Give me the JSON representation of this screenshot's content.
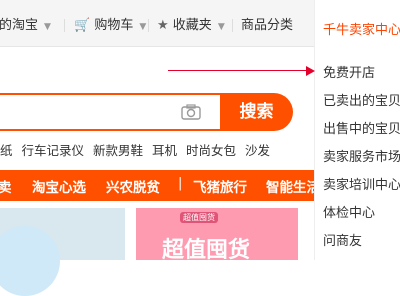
{
  "topbar": {
    "my_taobao": "我的淘宝",
    "cart": "购物车",
    "favorites": "收藏夹",
    "categories": "商品分类"
  },
  "seller_menu": {
    "title": "千牛卖家中心",
    "items": [
      "免费开店",
      "已卖出的宝贝",
      "出售中的宝贝",
      "卖家服务市场",
      "卖家培训中心",
      "体检中心",
      "问商友"
    ]
  },
  "search": {
    "button": "搜索"
  },
  "hot_words": [
    "纸",
    "行车记录仪",
    "新款男鞋",
    "耳机",
    "时尚女包",
    "沙发"
  ],
  "nav": {
    "items": [
      "淘宝心选",
      "兴农脱贫",
      "|",
      "飞猪旅行",
      "智能生活"
    ],
    "first_partial": "卖"
  },
  "promo": {
    "badge": "超值囤货",
    "headline": "超值囤货"
  },
  "colors": {
    "accent": "#ff5000",
    "arrow": "#e4002b"
  }
}
